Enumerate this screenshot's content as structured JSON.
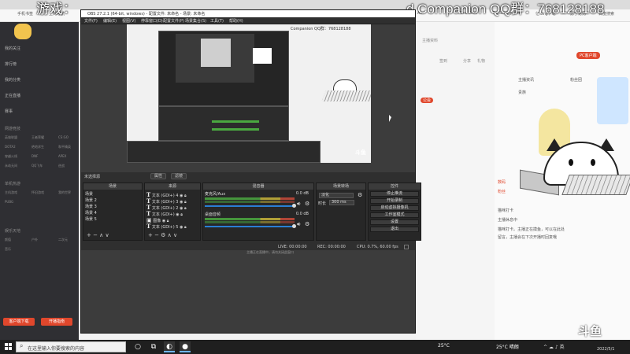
{
  "overlay": {
    "game_text": "游戏：",
    "companion_text": "d Companion    QQ群：768128188"
  },
  "bookmarks": [
    "手机书签",
    "上网导航",
    "Ac",
    "God Zone",
    "ProSettings.net",
    "亿 Jing下载",
    "苏宁易购",
    "百度搜索"
  ],
  "sidebar": {
    "items": [
      "我的关注",
      "排行榜",
      "我的分类",
      "正在直播",
      "赛事"
    ],
    "section1": "网游竞技",
    "section2": "单机热游",
    "section3": "娱乐天地",
    "small_items": [
      "英雄联盟",
      "王者荣耀",
      "CS:GO",
      "DOTA2",
      "绝地求生",
      "和平精英",
      "穿越火线",
      "DNF",
      "APEX",
      "永劫无间",
      "QQ飞车",
      "逆战",
      "主机游戏",
      "怀旧游戏",
      "我的世界",
      "PUBG",
      "颜值",
      "户外",
      "二次元",
      "音乐"
    ],
    "btn_left": "客户端下载",
    "btn_right": "开播指南"
  },
  "page_strip": {
    "items": [
      "PC客户端",
      "主播资料",
      "签到",
      "分享",
      "礼物"
    ],
    "tag": "公会"
  },
  "right_panel": {
    "items": [
      "主播资讯",
      "粉丝团",
      "贵族",
      "连麦",
      "聊天",
      "加入",
      "贵宾"
    ],
    "lines": [
      "数码",
      "粉丝",
      "猫咪打卡",
      "主播休息中",
      "Vtuber的直播间",
      "欢迎来到直播间",
      "猫咪打卡。主播正在摸鱼，可以在此处",
      "留言，主播会在下次开播时回复哦"
    ]
  },
  "obs": {
    "title": "OBS 27.2.1 (64-bit, windows) - 配置文件: 未命名 - 场景: 未命名",
    "menu": [
      "文件(F)",
      "编辑(E)",
      "视图(V)",
      "停靠窗口(D)",
      "配置文件(P)",
      "场景集合(S)",
      "工具(T)",
      "帮助(H)"
    ],
    "preview_title": "Companion    QQ群：768128188",
    "mode_title": "未选择源",
    "mode_checks": [
      "属性",
      "滤镜"
    ],
    "docks": {
      "scenes": {
        "title": "场景",
        "items": [
          "场景",
          "场景 2",
          "场景 3",
          "场景 4",
          "场景 5"
        ],
        "foot": "+  −   ∧  ∨"
      },
      "sources": {
        "title": "来源",
        "items": [
          "文本 (GDI+) 4",
          "文本 (GDI+) 3",
          "文本 (GDI+) 2",
          "文本 (GDI+)",
          "图像",
          "文本 (GDI+) 5"
        ],
        "foot": "+  −  ⚙  ∧  ∨"
      },
      "mixer": {
        "title": "混音器",
        "tracks": [
          {
            "name": "麦克风/Aux",
            "db": "0.0 dB"
          },
          {
            "name": "桌面音频",
            "db": "0.0 dB"
          }
        ]
      },
      "transitions": {
        "title": "场景转场",
        "type": "淡化",
        "duration_label": "时长",
        "duration_value": "300 ms"
      },
      "controls": {
        "title": "控件",
        "buttons": [
          "停止推流",
          "开始录制",
          "启动虚拟摄像机",
          "工作室模式",
          "设置",
          "退出"
        ]
      }
    },
    "status": {
      "live": "LIVE: 00:00:00",
      "rec": "REC: 00:00:00",
      "cpu": "CPU: 0.7%, 60.00 fps"
    },
    "hint": "主播正在直播中，请勿关闭此窗口"
  },
  "watermark": "斗鱼",
  "taskbar": {
    "search_placeholder": "在这里输入你要搜索的内容",
    "apps": [
      "○",
      "⧉",
      "◐",
      "●"
    ],
    "weather_left": "25°C",
    "weather_right": "25°C 晴朗",
    "tray": "^  ☁  ♪  英",
    "date": "2022/5/1"
  },
  "colors": {
    "obs_bg": "#2f2f2f",
    "accent_red": "#e0472c",
    "meter_green": "#4aa840",
    "slider_blue": "#2a7fd4"
  }
}
